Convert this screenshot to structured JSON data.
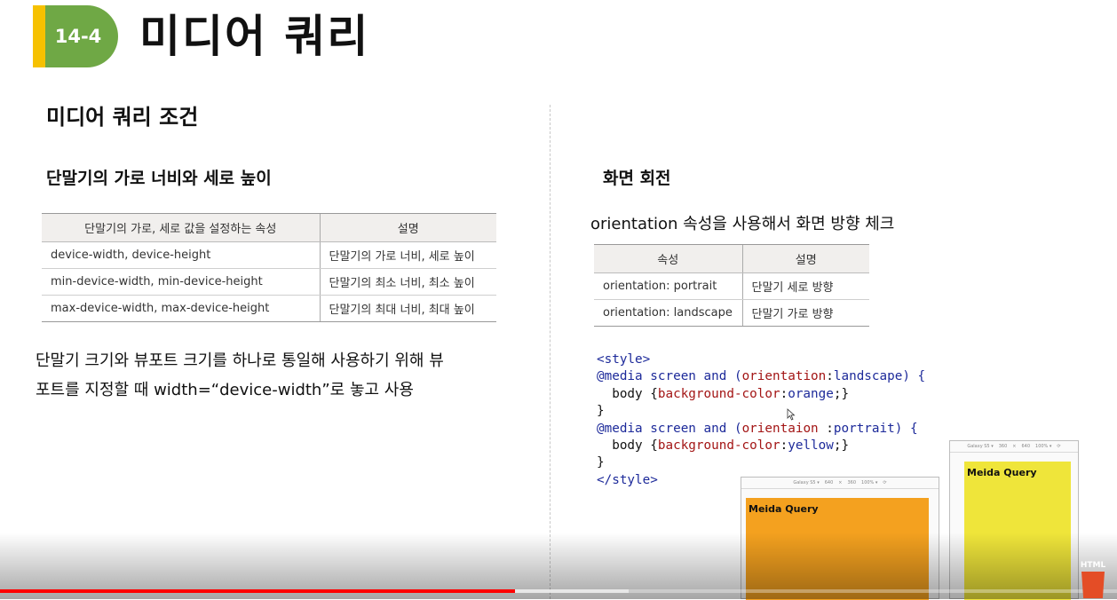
{
  "header": {
    "badge": "14-4",
    "title": "미디어 쿼리"
  },
  "left": {
    "section_title": "미디어 쿼리 조건",
    "subsection_title": "단말기의 가로 너비와 세로 높이",
    "table": {
      "headers": [
        "단말기의 가로, 세로 값을 설정하는 속성",
        "설명"
      ],
      "rows": [
        [
          "device-width, device-height",
          "단말기의 가로 너비, 세로 높이"
        ],
        [
          "min-device-width, min-device-height",
          "단말기의 최소 너비, 최소 높이"
        ],
        [
          "max-device-width, max-device-height",
          "단말기의 최대 너비, 최대 높이"
        ]
      ]
    },
    "paragraph_line1": "단말기 크기와 뷰포트 크기를 하나로 통일해 사용하기 위해 뷰",
    "paragraph_line2": "포트를 지정할 때 width=“device-width”로 놓고 사용"
  },
  "right": {
    "subsection_title": "화면 회전",
    "description": "orientation 속성을 사용해서 화면 방향 체크",
    "table": {
      "headers": [
        "속성",
        "설명"
      ],
      "rows": [
        [
          "orientation: portrait",
          "단말기 세로 방향"
        ],
        [
          "orientation: landscape",
          "단말기 가로 방향"
        ]
      ]
    },
    "code": {
      "l1": "<style>",
      "l2_media": "@media",
      "l2_screen": "screen",
      "l2_and": "and",
      "l2_open": "(",
      "l2_prop": "orientation",
      "l2_colon": ":",
      "l2_val": "landscape",
      "l2_close": ") {",
      "l3_sel": "  body {",
      "l3_prop": "background-color",
      "l3_colon": ":",
      "l3_val": "orange",
      "l3_end": ";}",
      "l4": "}",
      "l5_media": "@media",
      "l5_screen": "screen",
      "l5_and": "and",
      "l5_open": "(",
      "l5_prop": "orientaion",
      "l5_colon": " :",
      "l5_val": "portrait",
      "l5_close": ") {",
      "l6_sel": "  body {",
      "l6_prop": "background-color",
      "l6_colon": ":",
      "l6_val": "yellow",
      "l6_end": ";}",
      "l7": "}",
      "l8": "</style>"
    },
    "preview_landscape": {
      "toolbar": [
        "Galaxy S5 ▾",
        "640",
        "×",
        "360",
        "100% ▾",
        "⟳"
      ],
      "label": "Meida Query",
      "color": "#f4a11f"
    },
    "preview_portrait": {
      "toolbar": [
        "Galaxy S5 ▾",
        "360",
        "×",
        "640",
        "100% ▾",
        "⟳"
      ],
      "label": "Meida Query",
      "color": "#efe53a"
    }
  },
  "corner_logo": "HTML",
  "video": {
    "played_fraction": 0.461,
    "buffered_fraction": 0.563
  }
}
